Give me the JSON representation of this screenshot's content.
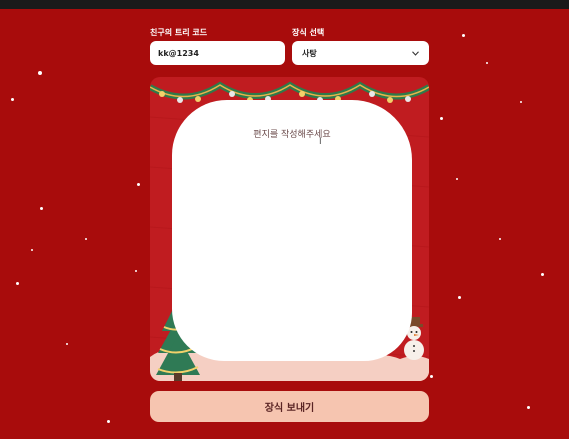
{
  "form": {
    "friend_code_label": "친구의 트리 코드",
    "friend_code_value": "kk@1234",
    "decoration_label": "장식 선택",
    "decoration_selected": "사탕"
  },
  "letter": {
    "placeholder": "편지를 작성해주세요"
  },
  "actions": {
    "send_label": "장식 보내기"
  },
  "icons": {
    "dropdown": "chevron-down-icon",
    "cursor": "text-cursor-icon",
    "tree": "christmas-tree-icon",
    "snowman": "snowman-icon"
  },
  "colors": {
    "background": "#a80c0c",
    "card": "#c01c20",
    "button": "#f6c5b0",
    "garland": "#2f7a4a"
  }
}
